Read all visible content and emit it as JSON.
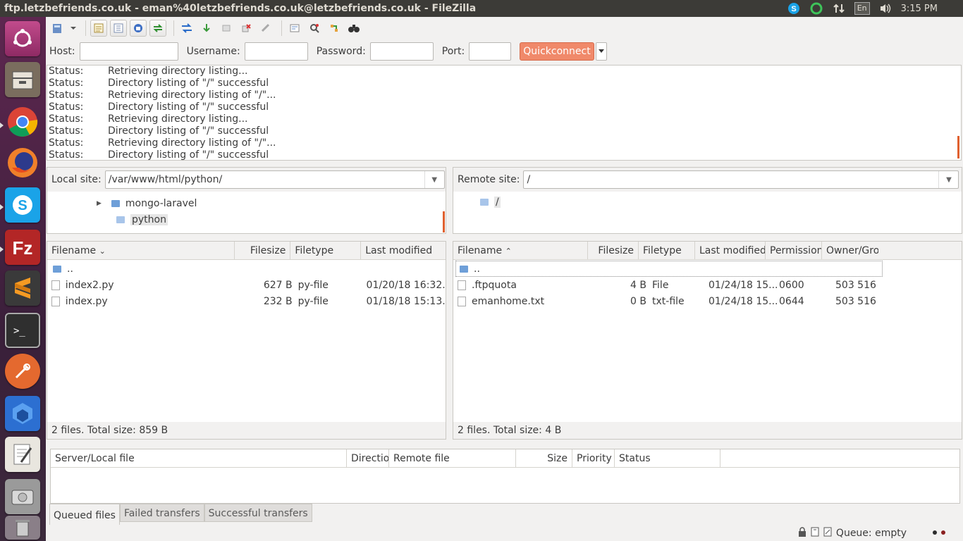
{
  "window": {
    "title": "ftp.letzbefriends.co.uk - eman%40letzbefriends.co.uk@letzbefriends.co.uk - FileZilla"
  },
  "tray": {
    "keyboard": "En",
    "time": "3:15 PM"
  },
  "launcher": [
    "ubuntu-logo",
    "files",
    "chrome",
    "firefox",
    "skype",
    "filezilla",
    "sublime-text",
    "terminal",
    "postman",
    "app-hexagon",
    "text-editor",
    "disk",
    "trash"
  ],
  "quickconnect": {
    "host_label": "Host:",
    "username_label": "Username:",
    "password_label": "Password:",
    "port_label": "Port:",
    "host_value": "",
    "username_value": "",
    "password_value": "",
    "port_value": "",
    "button": "Quickconnect"
  },
  "log": [
    {
      "key": "Status:",
      "msg": "Retrieving directory listing..."
    },
    {
      "key": "Status:",
      "msg": "Directory listing of \"/\" successful"
    },
    {
      "key": "Status:",
      "msg": "Retrieving directory listing of \"/\"..."
    },
    {
      "key": "Status:",
      "msg": "Directory listing of \"/\" successful"
    },
    {
      "key": "Status:",
      "msg": "Retrieving directory listing..."
    },
    {
      "key": "Status:",
      "msg": "Directory listing of \"/\" successful"
    },
    {
      "key": "Status:",
      "msg": "Retrieving directory listing of \"/\"..."
    },
    {
      "key": "Status:",
      "msg": "Directory listing of \"/\" successful"
    }
  ],
  "local": {
    "site_label": "Local site:",
    "path": "/var/www/html/python/",
    "tree": [
      "mongo-laravel",
      "python"
    ],
    "columns": [
      "Filename",
      "Filesize",
      "Filetype",
      "Last modified"
    ],
    "parent": "..",
    "files": [
      {
        "name": "index2.py",
        "size": "627 B",
        "type": "py-file",
        "modified": "01/20/18 16:32..."
      },
      {
        "name": "index.py",
        "size": "232 B",
        "type": "py-file",
        "modified": "01/18/18 15:13..."
      }
    ],
    "status": "2 files. Total size: 859 B"
  },
  "remote": {
    "site_label": "Remote site:",
    "path": "/",
    "tree": [
      "/"
    ],
    "columns": [
      "Filename",
      "Filesize",
      "Filetype",
      "Last modified",
      "Permission",
      "Owner/Gro"
    ],
    "parent": "..",
    "files": [
      {
        "name": ".ftpquota",
        "size": "4 B",
        "type": "File",
        "modified": "01/24/18 15...",
        "perm": "0600",
        "owner": "503 516"
      },
      {
        "name": "emanhome.txt",
        "size": "0 B",
        "type": "txt-file",
        "modified": "01/24/18 15...",
        "perm": "0644",
        "owner": "503 516"
      }
    ],
    "status": "2 files. Total size: 4 B"
  },
  "queue": {
    "columns": [
      "Server/Local file",
      "Directio",
      "Remote file",
      "Size",
      "Priority",
      "Status"
    ],
    "tabs": [
      "Queued files",
      "Failed transfers",
      "Successful transfers"
    ]
  },
  "statusbar": {
    "queue": "Queue: empty"
  },
  "colors": {
    "accent": "#f0896a",
    "topbar": "#3c3b37",
    "launcher": "#5e2750"
  }
}
